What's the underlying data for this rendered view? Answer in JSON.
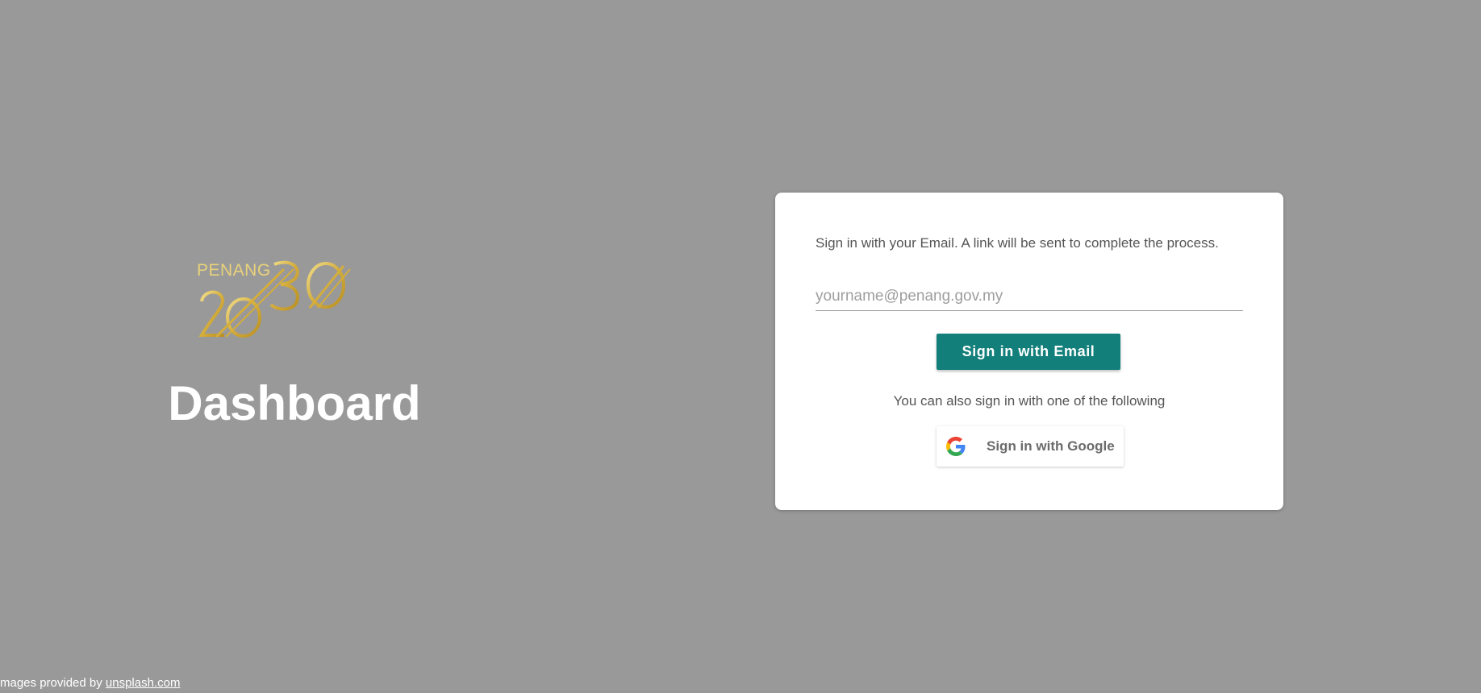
{
  "brand": {
    "logo_word": "PENANG",
    "logo_year": "2030",
    "title": "Dashboard"
  },
  "login": {
    "instructions": "Sign in with your Email. A link will be sent to complete the process.",
    "email_placeholder": "yourname@penang.gov.my",
    "email_button_label": "Sign in with Email",
    "alternative_text": "You can also sign in with one of the following",
    "google_button_label": "Sign in with Google",
    "google_icon": "google-logo-icon"
  },
  "footer": {
    "credit_prefix": "mages provided by ",
    "credit_link": "unsplash.com"
  },
  "colors": {
    "background": "#999999",
    "card": "#ffffff",
    "accent": "#127f7b",
    "logo_gold": "#d9b94a"
  }
}
